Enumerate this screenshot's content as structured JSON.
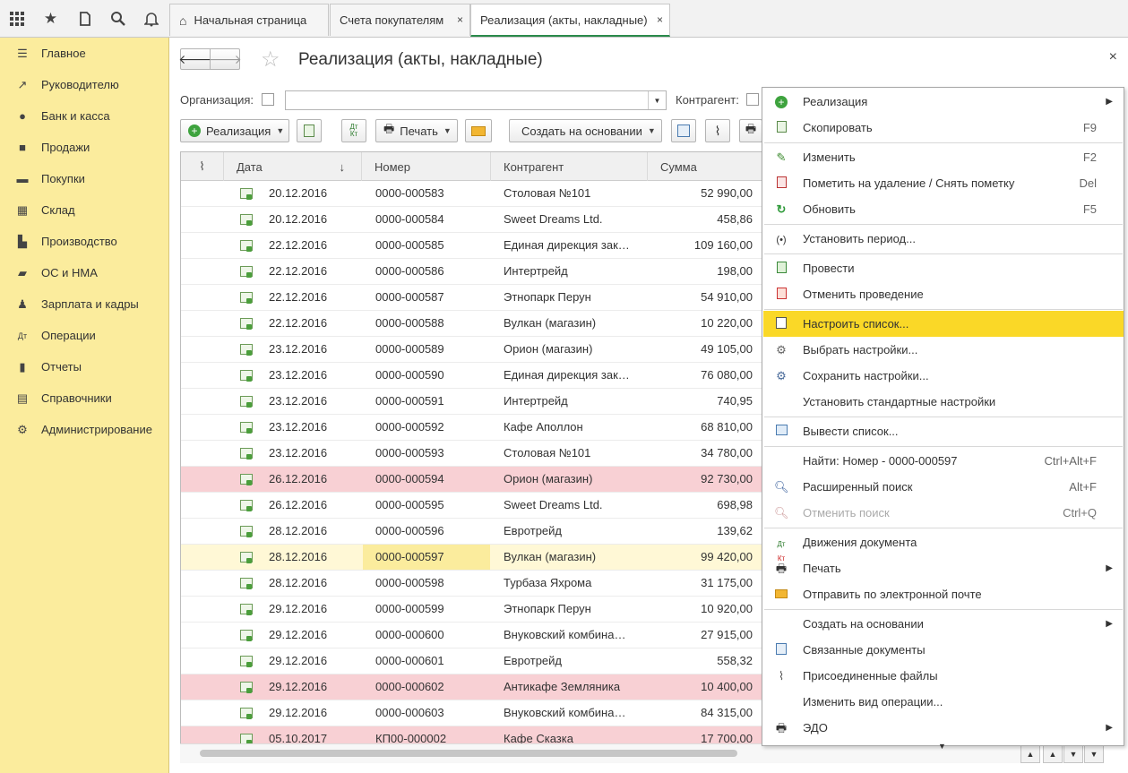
{
  "topbar": {
    "icons": [
      "apps-grid-icon",
      "favorites-star-icon",
      "history-icon",
      "search-icon",
      "notifications-bell-icon"
    ],
    "tabs": [
      {
        "label": "Начальная страница",
        "icon": "home-icon"
      },
      {
        "label": "Счета покупателям",
        "close": "×"
      },
      {
        "label": "Реализация (акты, накладные)",
        "close": "×"
      }
    ]
  },
  "sidebar": {
    "items": [
      {
        "label": "Главное",
        "icon": "menu-lines-icon"
      },
      {
        "label": "Руководителю",
        "icon": "trend-chart-icon"
      },
      {
        "label": "Банк и касса",
        "icon": "coin-icon"
      },
      {
        "label": "Продажи",
        "icon": "shopping-bag-icon"
      },
      {
        "label": "Покупки",
        "icon": "cart-icon"
      },
      {
        "label": "Склад",
        "icon": "warehouse-icon"
      },
      {
        "label": "Производство",
        "icon": "factory-icon"
      },
      {
        "label": "ОС и НМА",
        "icon": "truck-icon"
      },
      {
        "label": "Зарплата и кадры",
        "icon": "person-icon"
      },
      {
        "label": "Операции",
        "icon": "dt-kt-icon"
      },
      {
        "label": "Отчеты",
        "icon": "bar-chart-icon"
      },
      {
        "label": "Справочники",
        "icon": "books-icon"
      },
      {
        "label": "Администрирование",
        "icon": "gear-icon"
      }
    ]
  },
  "page": {
    "title": "Реализация (акты, накладные)",
    "close": "×",
    "filters": {
      "org_label": "Организация:",
      "org_value": "",
      "contractor_label": "Контрагент:"
    }
  },
  "toolbar": {
    "realization": "Реализация",
    "print": "Печать",
    "create_based_on": "Создать на основании",
    "dtkt_icon_text": "Дт Кт"
  },
  "table": {
    "columns": [
      "Дата",
      "Номер",
      "Контрагент",
      "Сумма"
    ],
    "sort_indicator": "↓",
    "rows": [
      {
        "date": "20.12.2016",
        "num": "0000-000583",
        "cp": "Столовая №101",
        "sum": "52 990,00",
        "style": ""
      },
      {
        "date": "20.12.2016",
        "num": "0000-000584",
        "cp": "Sweet Dreams Ltd.",
        "sum": "458,86",
        "style": ""
      },
      {
        "date": "22.12.2016",
        "num": "0000-000585",
        "cp": "Единая дирекция зак…",
        "sum": "109 160,00",
        "style": ""
      },
      {
        "date": "22.12.2016",
        "num": "0000-000586",
        "cp": "Интертрейд",
        "sum": "198,00",
        "style": ""
      },
      {
        "date": "22.12.2016",
        "num": "0000-000587",
        "cp": "Этнопарк Перун",
        "sum": "54 910,00",
        "style": ""
      },
      {
        "date": "22.12.2016",
        "num": "0000-000588",
        "cp": "Вулкан (магазин)",
        "sum": "10 220,00",
        "style": ""
      },
      {
        "date": "23.12.2016",
        "num": "0000-000589",
        "cp": "Орион (магазин)",
        "sum": "49 105,00",
        "style": ""
      },
      {
        "date": "23.12.2016",
        "num": "0000-000590",
        "cp": "Единая дирекция зак…",
        "sum": "76 080,00",
        "style": ""
      },
      {
        "date": "23.12.2016",
        "num": "0000-000591",
        "cp": "Интертрейд",
        "sum": "740,95",
        "style": ""
      },
      {
        "date": "23.12.2016",
        "num": "0000-000592",
        "cp": "Кафе Аполлон",
        "sum": "68 810,00",
        "style": ""
      },
      {
        "date": "23.12.2016",
        "num": "0000-000593",
        "cp": "Столовая №101",
        "sum": "34 780,00",
        "style": ""
      },
      {
        "date": "26.12.2016",
        "num": "0000-000594",
        "cp": "Орион (магазин)",
        "sum": "92 730,00",
        "style": "pink"
      },
      {
        "date": "26.12.2016",
        "num": "0000-000595",
        "cp": "Sweet Dreams Ltd.",
        "sum": "698,98",
        "style": ""
      },
      {
        "date": "28.12.2016",
        "num": "0000-000596",
        "cp": "Евротрейд",
        "sum": "139,62",
        "style": ""
      },
      {
        "date": "28.12.2016",
        "num": "0000-000597",
        "cp": "Вулкан (магазин)",
        "sum": "99 420,00",
        "style": "sel"
      },
      {
        "date": "28.12.2016",
        "num": "0000-000598",
        "cp": "Турбаза Яхрома",
        "sum": "31 175,00",
        "style": ""
      },
      {
        "date": "29.12.2016",
        "num": "0000-000599",
        "cp": "Этнопарк Перун",
        "sum": "10 920,00",
        "style": ""
      },
      {
        "date": "29.12.2016",
        "num": "0000-000600",
        "cp": "Внуковский комбина…",
        "sum": "27 915,00",
        "style": ""
      },
      {
        "date": "29.12.2016",
        "num": "0000-000601",
        "cp": "Евротрейд",
        "sum": "558,32",
        "style": ""
      },
      {
        "date": "29.12.2016",
        "num": "0000-000602",
        "cp": "Антикафе Земляника",
        "sum": "10 400,00",
        "style": "pink"
      },
      {
        "date": "29.12.2016",
        "num": "0000-000603",
        "cp": "Внуковский комбина…",
        "sum": "84 315,00",
        "style": ""
      },
      {
        "date": "05.10.2017",
        "num": "КП00-000002",
        "cp": "Кафе Сказка",
        "sum": "17 700,00",
        "style": "pink"
      }
    ]
  },
  "menu": {
    "items": [
      {
        "label": "Реализация",
        "shortcut": "",
        "submenu": true,
        "icon": "add-green-icon",
        "sep_after": false
      },
      {
        "label": "Скопировать",
        "shortcut": "F9",
        "submenu": false,
        "icon": "copy-icon",
        "sep_after": true
      },
      {
        "label": "Изменить",
        "shortcut": "F2",
        "submenu": false,
        "icon": "pencil-icon",
        "sep_after": false
      },
      {
        "label": "Пометить на удаление / Снять пометку",
        "shortcut": "Del",
        "submenu": false,
        "icon": "mark-delete-icon",
        "sep_after": false
      },
      {
        "label": "Обновить",
        "shortcut": "F5",
        "submenu": false,
        "icon": "refresh-icon",
        "sep_after": true
      },
      {
        "label": "Установить период...",
        "shortcut": "",
        "submenu": false,
        "icon": "period-icon",
        "sep_after": true
      },
      {
        "label": "Провести",
        "shortcut": "",
        "submenu": false,
        "icon": "post-icon",
        "sep_after": false
      },
      {
        "label": "Отменить проведение",
        "shortcut": "",
        "submenu": false,
        "icon": "unpost-icon",
        "sep_after": true
      },
      {
        "label": "Настроить список...",
        "shortcut": "",
        "submenu": false,
        "icon": "configure-list-icon",
        "sep_after": false,
        "highlight": true
      },
      {
        "label": "Выбрать настройки...",
        "shortcut": "",
        "submenu": false,
        "icon": "choose-settings-icon",
        "sep_after": false
      },
      {
        "label": "Сохранить настройки...",
        "shortcut": "",
        "submenu": false,
        "icon": "save-settings-icon",
        "sep_after": false
      },
      {
        "label": "Установить стандартные настройки",
        "shortcut": "",
        "submenu": false,
        "icon": "",
        "sep_after": true
      },
      {
        "label": "Вывести список...",
        "shortcut": "",
        "submenu": false,
        "icon": "output-list-icon",
        "sep_after": true
      },
      {
        "label": "Найти: Номер - 0000-000597",
        "shortcut": "Ctrl+Alt+F",
        "submenu": false,
        "icon": "",
        "sep_after": false
      },
      {
        "label": "Расширенный поиск",
        "shortcut": "Alt+F",
        "submenu": false,
        "icon": "search-icon",
        "sep_after": false
      },
      {
        "label": "Отменить поиск",
        "shortcut": "Ctrl+Q",
        "submenu": false,
        "icon": "cancel-search-icon",
        "sep_after": true,
        "disabled": true
      },
      {
        "label": "Движения документа",
        "shortcut": "",
        "submenu": false,
        "icon": "dt-kt-icon",
        "sep_after": false
      },
      {
        "label": "Печать",
        "shortcut": "",
        "submenu": true,
        "icon": "printer-icon",
        "sep_after": false
      },
      {
        "label": "Отправить по электронной почте",
        "shortcut": "",
        "submenu": false,
        "icon": "envelope-icon",
        "sep_after": true
      },
      {
        "label": "Создать на основании",
        "shortcut": "",
        "submenu": true,
        "icon": "",
        "sep_after": false
      },
      {
        "label": "Связанные документы",
        "shortcut": "",
        "submenu": false,
        "icon": "related-docs-icon",
        "sep_after": false
      },
      {
        "label": "Присоединенные файлы",
        "shortcut": "",
        "submenu": false,
        "icon": "paperclip-icon",
        "sep_after": false
      },
      {
        "label": "Изменить вид операции...",
        "shortcut": "",
        "submenu": false,
        "icon": "",
        "sep_after": false
      },
      {
        "label": "ЭДО",
        "shortcut": "",
        "submenu": true,
        "icon": "edo-icon",
        "sep_after": false
      }
    ]
  }
}
